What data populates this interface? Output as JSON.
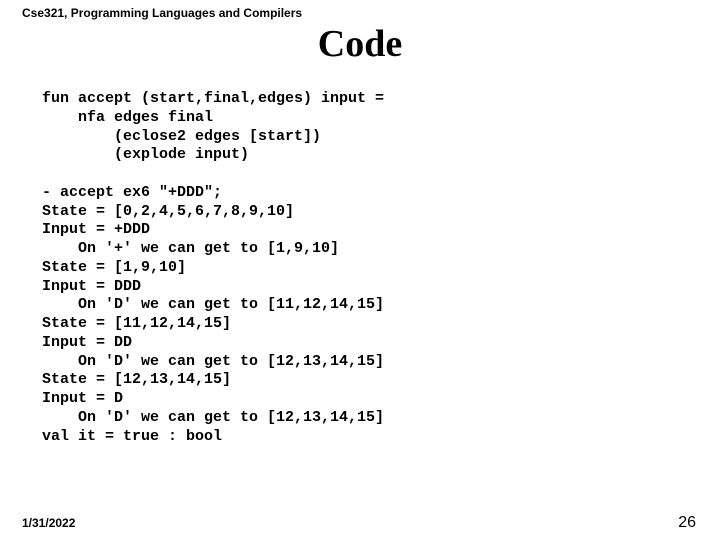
{
  "header": {
    "course": "Cse321, Programming Languages and Compilers"
  },
  "title": "Code",
  "code": {
    "l01": "fun accept (start,final,edges) input =",
    "l02": "    nfa edges final",
    "l03": "        (eclose2 edges [start])",
    "l04": "        (explode input)",
    "l05": "",
    "l06": "- accept ex6 \"+DDD\";",
    "l07": "State = [0,2,4,5,6,7,8,9,10]",
    "l08": "Input = +DDD",
    "l09": "    On '+' we can get to [1,9,10]",
    "l10": "State = [1,9,10]",
    "l11": "Input = DDD",
    "l12": "    On 'D' we can get to [11,12,14,15]",
    "l13": "State = [11,12,14,15]",
    "l14": "Input = DD",
    "l15": "    On 'D' we can get to [12,13,14,15]",
    "l16": "State = [12,13,14,15]",
    "l17": "Input = D",
    "l18": "    On 'D' we can get to [12,13,14,15]",
    "l19": "val it = true : bool"
  },
  "footer": {
    "date": "1/31/2022",
    "page": "26"
  }
}
